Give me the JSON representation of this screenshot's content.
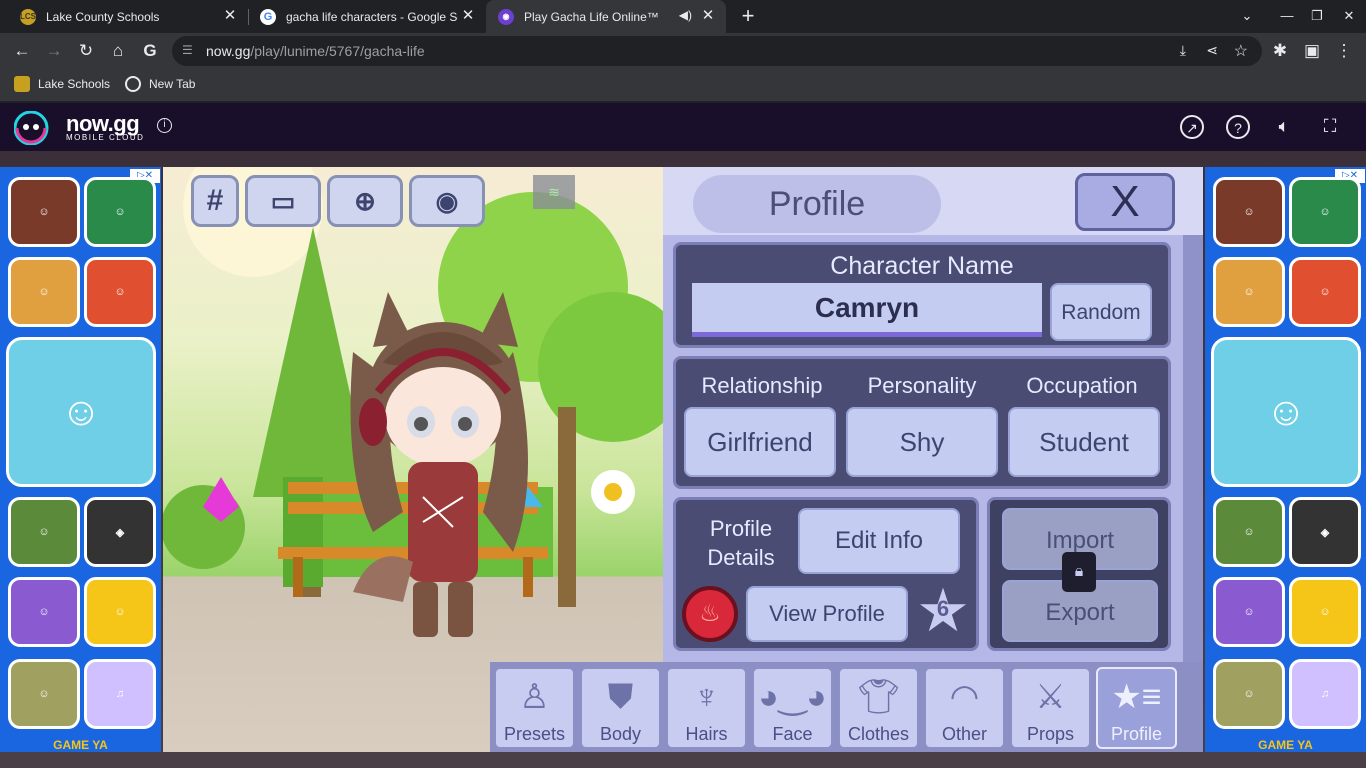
{
  "browser": {
    "tabs": [
      {
        "title": "Lake County Schools",
        "favicon": "lcs-icon"
      },
      {
        "title": "gacha life characters - Google Se",
        "favicon": "google-icon"
      },
      {
        "title": "Play Gacha Life Online™",
        "favicon": "nowgg-icon"
      }
    ],
    "url_domain": "now.gg",
    "url_path": "/play/lunime/5767/gacha-life",
    "bookmarks": [
      "Lake Schools",
      "New Tab"
    ]
  },
  "nowgg": {
    "logo": "now.gg",
    "logo_sub": "MOBILE CLOUD"
  },
  "ads": {
    "footer": "GAME YA"
  },
  "game": {
    "toolbar": {
      "hash": "#"
    },
    "panel_title": "Profile",
    "close_label": "X",
    "character_name_label": "Character Name",
    "character_name": "Camryn",
    "random_label": "Random",
    "relationship_label": "Relationship",
    "personality_label": "Personality",
    "occupation_label": "Occupation",
    "relationship_value": "Girlfriend",
    "personality_value": "Shy",
    "occupation_value": "Student",
    "profile_details_label": "Profile\nDetails",
    "edit_info_label": "Edit Info",
    "view_profile_label": "View Profile",
    "star_count": "6",
    "import_label": "Import",
    "export_label": "Export",
    "tabs": [
      "Presets",
      "Body",
      "Hairs",
      "Face",
      "Clothes",
      "Other",
      "Props",
      "Profile"
    ]
  },
  "colors": {
    "accent": "#8b8fc4",
    "panel": "#b5b7e6",
    "box": "#4a4c73"
  }
}
